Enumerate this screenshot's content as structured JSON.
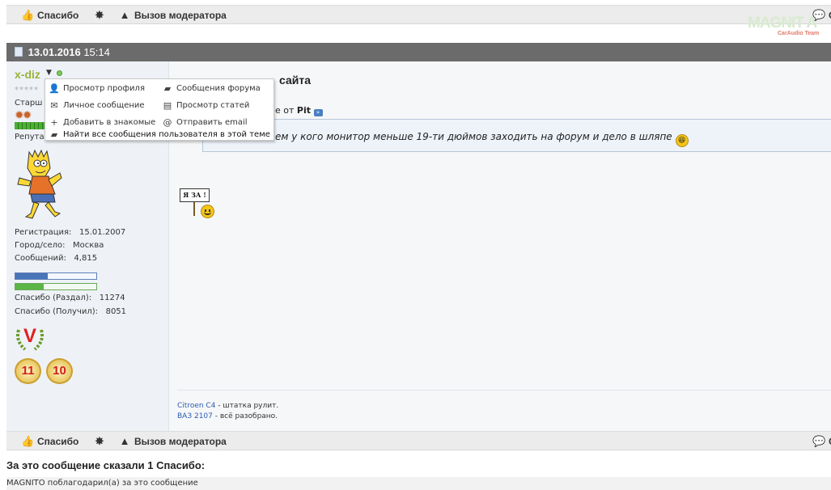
{
  "toolbar_top": {
    "thanks_label": "Спасибо",
    "moderator_label": "Вызов модератора",
    "right_label": "С"
  },
  "watermark": {
    "brand": "MAGNIT A",
    "sub": "CarAudio Team"
  },
  "post": {
    "date": "13.01.2016",
    "time": "15:14",
    "title_visible": "сайта",
    "quote_header_prefix": "е от",
    "quote_author": "Pit",
    "quote_text": "ем у кого монитор меньше 19-ти дюймов заходить на форум и дело в шляпе",
    "sign_text": "Я ЗА !",
    "signature": [
      {
        "link": "Citroen C4",
        "rest": " - штатка рулит."
      },
      {
        "link": "ВАЗ 2107",
        "rest": " - всё разобрано."
      }
    ]
  },
  "user": {
    "name": "x-diz",
    "stars": "*****",
    "rank_partial": "Старш",
    "reputation_partial": "Репута",
    "registration_label": "Регистрация:",
    "registration_value": "15.01.2007",
    "city_label": "Город/село:",
    "city_value": "Москва",
    "posts_label": "Сообщений:",
    "posts_value": "4,815",
    "thanks_given_label": "Спасибо (Раздал):",
    "thanks_given_value": "11274",
    "thanks_received_label": "Спасибо (Получил):",
    "thanks_received_value": "8051",
    "award_v": "V",
    "award_11": "11",
    "award_10": "10",
    "bar_blue_fill": 0.4,
    "bar_green_fill": 0.35
  },
  "popup_menu": {
    "view_profile": "Просмотр профиля",
    "forum_posts": "Сообщения форума",
    "private_message": "Личное сообщение",
    "view_articles": "Просмотр статей",
    "add_friend": "Добавить в знакомые",
    "send_email": "Отправить email",
    "find_all": "Найти все сообщения пользователя в этой теме"
  },
  "toolbar_bottom": {
    "thanks_label": "Спасибо",
    "moderator_label": "Вызов модератора",
    "right_label": "С"
  },
  "thanks_summary": {
    "title": "За это сообщение сказали 1 Спасибо:",
    "line": "МАGNITO поблагодарил(а) за это сообщение"
  },
  "colors": {
    "username": "#9ab23a",
    "date_bar": "#6b6b6b",
    "link": "#2a5db0"
  }
}
